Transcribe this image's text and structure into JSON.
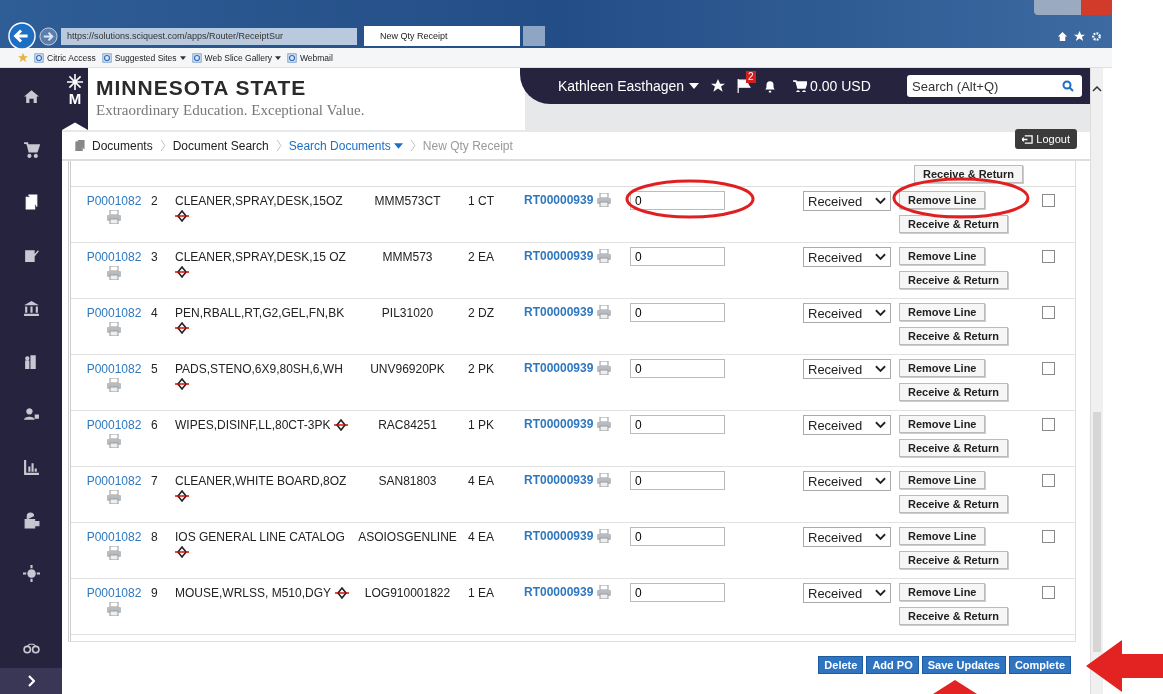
{
  "browser": {
    "address": "https://solutions.sciquest.com/apps/Router/ReceiptSur",
    "tab_title": "New Qty Receipt",
    "favorites": [
      {
        "label": "Citric Access",
        "has_menu": false
      },
      {
        "label": "Suggested Sites",
        "has_menu": true
      },
      {
        "label": "Web Slice Gallery",
        "has_menu": true
      },
      {
        "label": "Webmail",
        "has_menu": false
      }
    ]
  },
  "header": {
    "brand": "MINNESOTA STATE",
    "logo_letter": "M",
    "tagline": "Extraordinary Education. Exceptional Value.",
    "user": "Kathleen Easthagen",
    "flag_count": "2",
    "cart": "0.00 USD",
    "search": {
      "placeholder": "Search (Alt+Q)"
    }
  },
  "breadcrumb": [
    {
      "label": "Documents",
      "kind": "plain"
    },
    {
      "label": "Document Search",
      "kind": "plain"
    },
    {
      "label": "Search Documents",
      "kind": "link"
    },
    {
      "label": "New Qty Receipt",
      "kind": "current"
    }
  ],
  "logout": "Logout",
  "partial_row": {
    "button": "Receive & Return"
  },
  "rows": [
    {
      "po": "P0001082",
      "line": "2",
      "description": "CLEANER,SPRAY,DESK,15OZ",
      "part": "MMM573CT",
      "qty": "1 CT",
      "receipt": "RT00000939",
      "received_qty": "0",
      "status": "Received",
      "remove": "Remove Line",
      "return": "Receive & Return",
      "checked": false
    },
    {
      "po": "P0001082",
      "line": "3",
      "description": "CLEANER,SPRAY,DESK,15 OZ",
      "part": "MMM573",
      "qty": "2 EA",
      "receipt": "RT00000939",
      "received_qty": "0",
      "status": "Received",
      "remove": "Remove Line",
      "return": "Receive & Return",
      "checked": false
    },
    {
      "po": "P0001082",
      "line": "4",
      "description": "PEN,RBALL,RT,G2,GEL,FN,BK",
      "part": "PIL31020",
      "qty": "2 DZ",
      "receipt": "RT00000939",
      "received_qty": "0",
      "status": "Received",
      "remove": "Remove Line",
      "return": "Receive & Return",
      "checked": false
    },
    {
      "po": "P0001082",
      "line": "5",
      "description": "PADS,STENO,6X9,80SH,6,WH",
      "part": "UNV96920PK",
      "qty": "2 PK",
      "receipt": "RT00000939",
      "received_qty": "0",
      "status": "Received",
      "remove": "Remove Line",
      "return": "Receive & Return",
      "checked": false
    },
    {
      "po": "P0001082",
      "line": "6",
      "description": "WIPES,DISINF,LL,80CT-3PK",
      "part": "RAC84251",
      "qty": "1 PK",
      "receipt": "RT00000939",
      "received_qty": "0",
      "status": "Received",
      "remove": "Remove Line",
      "return": "Receive & Return",
      "checked": false
    },
    {
      "po": "P0001082",
      "line": "7",
      "description": "CLEANER,WHITE BOARD,8OZ",
      "part": "SAN81803",
      "qty": "4 EA",
      "receipt": "RT00000939",
      "received_qty": "0",
      "status": "Received",
      "remove": "Remove Line",
      "return": "Receive & Return",
      "checked": false
    },
    {
      "po": "P0001082",
      "line": "8",
      "description": "IOS GENERAL LINE CATALOG",
      "part": "ASOIOSGENLINE",
      "qty": "4 EA",
      "receipt": "RT00000939",
      "received_qty": "0",
      "status": "Received",
      "remove": "Remove Line",
      "return": "Receive & Return",
      "checked": false
    },
    {
      "po": "P0001082",
      "line": "9",
      "description": "MOUSE,WRLSS, M510,DGY",
      "part": "LOG910001822",
      "qty": "1 EA",
      "receipt": "RT00000939",
      "received_qty": "0",
      "status": "Received",
      "remove": "Remove Line",
      "return": "Receive & Return",
      "checked": false
    }
  ],
  "actions": [
    "Delete",
    "Add PO",
    "Save Updates",
    "Complete"
  ]
}
